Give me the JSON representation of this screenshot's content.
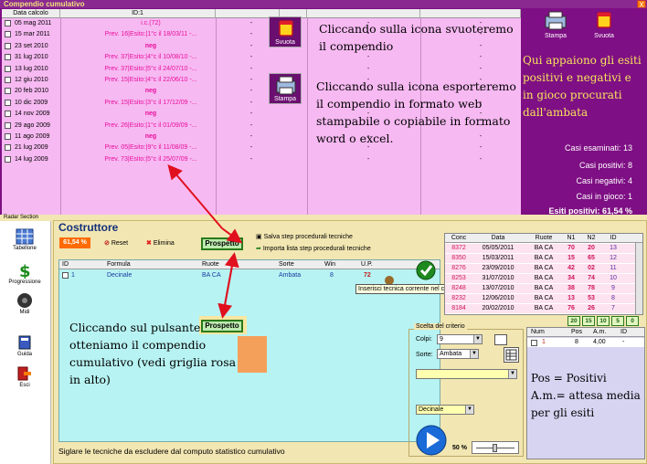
{
  "top_window": {
    "title": "Compendio cumulativo",
    "close_label": "X",
    "columns": [
      "Data calcolo",
      "ID:1",
      "",
      "",
      "",
      ""
    ],
    "rows": [
      {
        "date": "05 mag 2011",
        "esito": "i.c.(72)",
        "neg": false
      },
      {
        "date": "15 mar 2011",
        "esito": "Prev. 16|Esito:|1°c il 18/03/11 -...",
        "neg": false
      },
      {
        "date": "23 set 2010",
        "esito": "neg",
        "neg": true
      },
      {
        "date": "31 lug 2010",
        "esito": "Prev. 37|Esito:|4°c il 10/08/10 -...",
        "neg": false
      },
      {
        "date": "13 lug 2010",
        "esito": "Prev. 37|Esito:|5°c il 24/07/10 -...",
        "neg": false
      },
      {
        "date": "12 giu 2010",
        "esito": "Prev. 15|Esito:|4°c il 22/06/10 -...",
        "neg": false
      },
      {
        "date": "20 feb 2010",
        "esito": "neg",
        "neg": true
      },
      {
        "date": "10 dic 2009",
        "esito": "Prev. 15|Esito:|3°c il 17/12/09 -...",
        "neg": false
      },
      {
        "date": "14 nov 2009",
        "esito": "neg",
        "neg": true
      },
      {
        "date": "29 ago 2009",
        "esito": "Prev. 26|Esito:|1°c il 01/09/09 -...",
        "neg": false
      },
      {
        "date": "11 ago 2009",
        "esito": "neg",
        "neg": true
      },
      {
        "date": "21 lug 2009",
        "esito": "Prev. 05|Esito:|9°c il 11/08/09 -...",
        "neg": false
      },
      {
        "date": "14 lug 2009",
        "esito": "Prev. 73|Esito:|5°c il 25/07/09 -...",
        "neg": false
      }
    ],
    "dash": "-",
    "svuota_label": "Svuota",
    "stampa_label": "Stampa",
    "right_stampa_label": "Stampa",
    "right_svuota_label": "Svuota",
    "annotation_svuota": "Cliccando sulla icona svuoteremo il compendio",
    "annotation_stampa": "Cliccando sulla icona esporteremo il compendio in formato web stampabile o copiabile in formato word o excel.",
    "annotation_esiti": "Qui appaiono gli esiti positivi e negativi e in gioco procurati dall'ambata",
    "stats": {
      "esaminati": "Casi esaminati: 13",
      "positivi": "Casi positivi: 8",
      "negativi": "Casi negativi: 4",
      "in_gioco": "Casi in gioco: 1",
      "esiti_positivi": "Esiti positivi: 61,54 %"
    }
  },
  "sidebar": {
    "section_label": "Radar Section",
    "items": [
      {
        "label": "Tabellone"
      },
      {
        "label": "Progressione"
      },
      {
        "label": "Midi"
      },
      {
        "label": "Guida"
      },
      {
        "label": "Esci"
      }
    ]
  },
  "costruttore": {
    "title": "Costruttore",
    "percent": "61,54 %",
    "reset_label": "Reset",
    "elimina_label": "Elimina",
    "prospetto_label": "Prospetto",
    "salva_label": "Salva step procedurali tecniche",
    "importa_label": "Importa lista step procedurali tecniche",
    "columns": {
      "id": "ID",
      "formula": "Formula",
      "ruote": "Ruote",
      "sorte": "Sorte",
      "win": "Win",
      "up": "U.P."
    },
    "row": {
      "id": "1",
      "formula": "Decinale",
      "ruote": "BA CA",
      "sorte": "Ambata",
      "win": "8",
      "up": "72"
    },
    "tooltip": "Inserisci tecnica corrente nel contenitore finale",
    "annotation_prospetto_pre": "Cliccando sul pulsante",
    "annotation_prospetto_btn": "Prospetto",
    "annotation_prospetto_post": "otteniamo il compendio cumulativo (vedi griglia rosa in alto)",
    "status_text": "Siglare le tecniche da escludere dal computo statistico cumulativo"
  },
  "conc_table": {
    "columns": [
      "Conc",
      "Data",
      "Ruote",
      "N1",
      "N2",
      "ID"
    ],
    "rows": [
      [
        "8372",
        "05/05/2011",
        "BA CA",
        "70",
        "20",
        "13"
      ],
      [
        "8350",
        "15/03/2011",
        "BA CA",
        "15",
        "65",
        "12"
      ],
      [
        "8276",
        "23/09/2010",
        "BA CA",
        "42",
        "02",
        "11"
      ],
      [
        "8253",
        "31/07/2010",
        "BA CA",
        "34",
        "74",
        "10"
      ],
      [
        "8248",
        "13/07/2010",
        "BA CA",
        "38",
        "78",
        "9"
      ],
      [
        "8232",
        "12/06/2010",
        "BA CA",
        "13",
        "53",
        "8"
      ],
      [
        "8184",
        "20/02/2010",
        "BA CA",
        "76",
        "26",
        "7"
      ]
    ],
    "counters": [
      "20",
      "15",
      "10",
      "5",
      "0"
    ]
  },
  "criterio": {
    "title": "Scelta del criterio",
    "colpi_label": "Colpi:",
    "colpi_value": "9",
    "sorte_label": "Sorte:",
    "sorte_value": "Ambata",
    "formula_value": "Decinale",
    "zoom": "50 %"
  },
  "pos_panel": {
    "columns": [
      "Num",
      "Pos",
      "A.m.",
      "ID"
    ],
    "row": {
      "num": "1",
      "pos": "8",
      "am": "4,00",
      "id": "-"
    },
    "legend_pos": "Pos = Positivi",
    "legend_am": "A.m.= attesa media per gli esiti"
  },
  "colors": {
    "purple": "#7e0f84",
    "pink": "#f7b9f2",
    "cyan": "#b7f3f2",
    "beige": "#f2e6b2",
    "arrow": "#e0101f"
  }
}
